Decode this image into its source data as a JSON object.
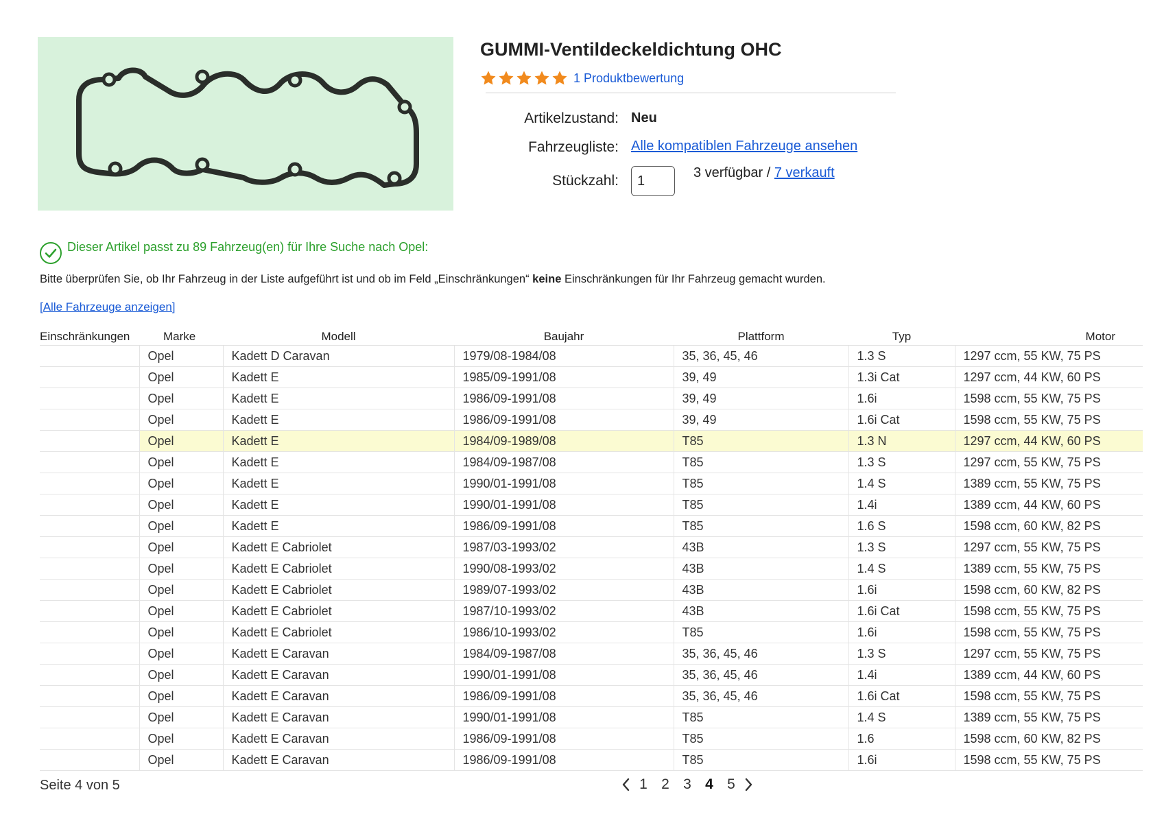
{
  "product": {
    "title": "GUMMI-Ventildeckeldichtung OHC",
    "rating_text": "1 Produktbewertung",
    "rating_stars": 5,
    "image_icon": "valve-cover-gasket-image"
  },
  "specs": {
    "condition_label": "Artikelzustand:",
    "condition_value": "Neu",
    "vehicles_label": "Fahrzeugliste:",
    "vehicles_link": "Alle kompatiblen Fahrzeuge ansehen",
    "qty_label": "Stückzahl:",
    "qty_value": "1",
    "available_text": "3 verfügbar /",
    "sold_link": "7 verkauft"
  },
  "compat": {
    "fit_message": "Dieser Artikel passt zu 89 Fahrzeug(en) für Ihre Suche nach Opel:",
    "check_prefix": "Bitte überprüfen Sie, ob Ihr Fahrzeug in der Liste aufgeführt ist und ob im Feld „Einschränkungen“",
    "check_bold": "keine",
    "check_suffix": "Einschränkungen für Ihr Fahrzeug gemacht wurden.",
    "show_all_link": "[Alle Fahrzeuge anzeigen]",
    "columns": [
      "Einschränkungen",
      "Marke",
      "Modell",
      "Baujahr",
      "Plattform",
      "Typ",
      "Motor"
    ],
    "rows": [
      [
        "",
        "Opel",
        "Kadett D Caravan",
        "1979/08-1984/08",
        "35, 36, 45, 46",
        "1.3 S",
        "1297 ccm, 55 KW, 75 PS"
      ],
      [
        "",
        "Opel",
        "Kadett E",
        "1985/09-1991/08",
        "39, 49",
        "1.3i Cat",
        "1297 ccm, 44 KW, 60 PS"
      ],
      [
        "",
        "Opel",
        "Kadett E",
        "1986/09-1991/08",
        "39, 49",
        "1.6i",
        "1598 ccm, 55 KW, 75 PS"
      ],
      [
        "",
        "Opel",
        "Kadett E",
        "1986/09-1991/08",
        "39, 49",
        "1.6i Cat",
        "1598 ccm, 55 KW, 75 PS"
      ],
      [
        "",
        "Opel",
        "Kadett E",
        "1984/09-1989/08",
        "T85",
        "1.3 N",
        "1297 ccm, 44 KW, 60 PS"
      ],
      [
        "",
        "Opel",
        "Kadett E",
        "1984/09-1987/08",
        "T85",
        "1.3 S",
        "1297 ccm, 55 KW, 75 PS"
      ],
      [
        "",
        "Opel",
        "Kadett E",
        "1990/01-1991/08",
        "T85",
        "1.4 S",
        "1389 ccm, 55 KW, 75 PS"
      ],
      [
        "",
        "Opel",
        "Kadett E",
        "1990/01-1991/08",
        "T85",
        "1.4i",
        "1389 ccm, 44 KW, 60 PS"
      ],
      [
        "",
        "Opel",
        "Kadett E",
        "1986/09-1991/08",
        "T85",
        "1.6 S",
        "1598 ccm, 60 KW, 82 PS"
      ],
      [
        "",
        "Opel",
        "Kadett E Cabriolet",
        "1987/03-1993/02",
        "43B",
        "1.3 S",
        "1297 ccm, 55 KW, 75 PS"
      ],
      [
        "",
        "Opel",
        "Kadett E Cabriolet",
        "1990/08-1993/02",
        "43B",
        "1.4 S",
        "1389 ccm, 55 KW, 75 PS"
      ],
      [
        "",
        "Opel",
        "Kadett E Cabriolet",
        "1989/07-1993/02",
        "43B",
        "1.6i",
        "1598 ccm, 60 KW, 82 PS"
      ],
      [
        "",
        "Opel",
        "Kadett E Cabriolet",
        "1987/10-1993/02",
        "43B",
        "1.6i Cat",
        "1598 ccm, 55 KW, 75 PS"
      ],
      [
        "",
        "Opel",
        "Kadett E Cabriolet",
        "1986/10-1993/02",
        "T85",
        "1.6i",
        "1598 ccm, 55 KW, 75 PS"
      ],
      [
        "",
        "Opel",
        "Kadett E Caravan",
        "1984/09-1987/08",
        "35, 36, 45, 46",
        "1.3 S",
        "1297 ccm, 55 KW, 75 PS"
      ],
      [
        "",
        "Opel",
        "Kadett E Caravan",
        "1990/01-1991/08",
        "35, 36, 45, 46",
        "1.4i",
        "1389 ccm, 44 KW, 60 PS"
      ],
      [
        "",
        "Opel",
        "Kadett E Caravan",
        "1986/09-1991/08",
        "35, 36, 45, 46",
        "1.6i Cat",
        "1598 ccm, 55 KW, 75 PS"
      ],
      [
        "",
        "Opel",
        "Kadett E Caravan",
        "1990/01-1991/08",
        "T85",
        "1.4 S",
        "1389 ccm, 55 KW, 75 PS"
      ],
      [
        "",
        "Opel",
        "Kadett E Caravan",
        "1986/09-1991/08",
        "T85",
        "1.6",
        "1598 ccm, 60 KW, 82 PS"
      ],
      [
        "",
        "Opel",
        "Kadett E Caravan",
        "1986/09-1991/08",
        "T85",
        "1.6i",
        "1598 ccm, 55 KW, 75 PS"
      ]
    ],
    "highlighted_row": 4
  },
  "pagination": {
    "page_info": "Seite 4 von 5",
    "pages": [
      "1",
      "2",
      "3",
      "4",
      "5"
    ],
    "current": "4",
    "prev_icon": "chevron-left-icon",
    "next_icon": "chevron-right-icon"
  },
  "colors": {
    "link": "#1a5bd6",
    "success": "#2ca02c",
    "star": "#f18a1d",
    "highlight": "#fbfbd2",
    "image_bg": "#d8f2dc"
  }
}
